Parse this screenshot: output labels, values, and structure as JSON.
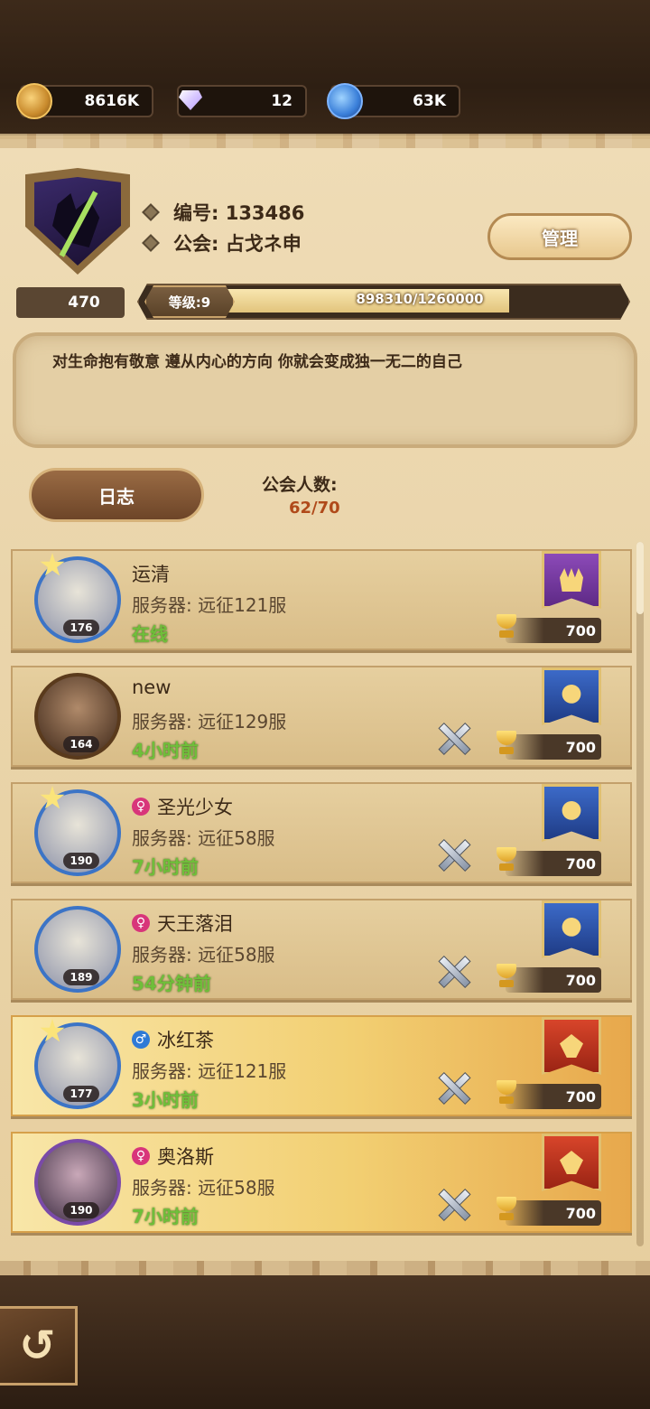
{
  "resources": {
    "gold": "8616K",
    "gems": "12",
    "dust": "63K"
  },
  "guild": {
    "id_label": "编号: 133486",
    "name_label": "公会: 占戈ネ申",
    "manage_button": "管理",
    "trophies": "470",
    "level_label": "等级:9",
    "exp_text": "898310/1260000",
    "exp_progress": 0.7128,
    "notice": "对生命抱有敬意 遵从内心的方向 你就会变成独一无二的自己",
    "log_button": "日志",
    "member_label": "公会人数:",
    "member_count": "62/70"
  },
  "members": [
    {
      "name": "运清",
      "gender": "",
      "level": "176",
      "server": "服务器: 远征121服",
      "status": "在线",
      "trophies": "700",
      "banner": "purple",
      "star": true,
      "swords": false,
      "highlight": false
    },
    {
      "name": "new",
      "gender": "",
      "level": "164",
      "server": "服务器: 远征129服",
      "status": "4小时前",
      "trophies": "700",
      "banner": "blue",
      "star": false,
      "swords": true,
      "highlight": false
    },
    {
      "name": "圣光少女",
      "gender": "female",
      "level": "190",
      "server": "服务器: 远征58服",
      "status": "7小时前",
      "trophies": "700",
      "banner": "blue",
      "star": true,
      "swords": true,
      "highlight": false
    },
    {
      "name": "天王落泪",
      "gender": "female",
      "level": "189",
      "server": "服务器: 远征58服",
      "status": "54分钟前",
      "trophies": "700",
      "banner": "blue",
      "star": false,
      "swords": true,
      "highlight": false
    },
    {
      "name": "冰红茶",
      "gender": "male",
      "level": "177",
      "server": "服务器: 远征121服",
      "status": "3小时前",
      "trophies": "700",
      "banner": "red",
      "star": true,
      "swords": true,
      "highlight": true
    },
    {
      "name": "奥洛斯",
      "gender": "female",
      "level": "190",
      "server": "服务器: 远征58服",
      "status": "7小时前",
      "trophies": "700",
      "banner": "red",
      "star": false,
      "swords": true,
      "highlight": true
    }
  ],
  "nav": {
    "back_glyph": "↺"
  }
}
